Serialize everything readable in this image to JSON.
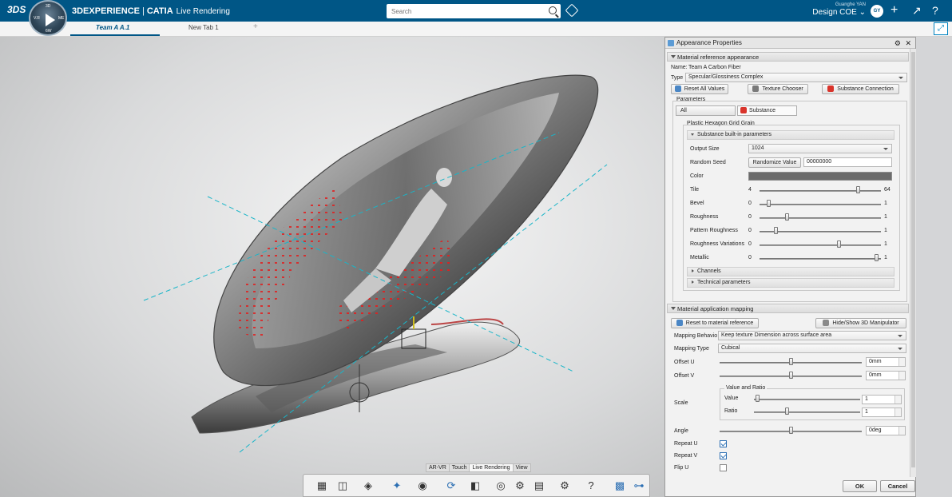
{
  "header": {
    "brand_prefix": "3DEXPERIENCE",
    "brand_app": "CATIA",
    "brand_context": "Live Rendering",
    "search_placeholder": "Search",
    "user_name": "Guanghe YAN",
    "collaborative_space": "Design COE",
    "avatar_initials": "GY",
    "compass_letters": {
      "top": "3D",
      "left": "V.R",
      "right": "ME",
      "bottom": "6W"
    }
  },
  "tabs": [
    {
      "label": "Team A A.1",
      "active": true
    },
    {
      "label": "New Tab 1",
      "active": false
    }
  ],
  "new_tab_symbol": "+",
  "workbench_tabs": [
    "AR-VR",
    "Touch",
    "Live Rendering",
    "View"
  ],
  "workbench_active": "Live Rendering",
  "toolbar_icons": [
    "scene-icon",
    "environment-icon",
    "material-icon",
    "lighting-icon",
    "camera-icon",
    "render-icon",
    "snapshot-icon",
    "turntable-icon",
    "settings-icon",
    "library-icon",
    "preferences-icon",
    "help-icon",
    "texture-icon",
    "tree-icon"
  ],
  "panel": {
    "title": "Appearance Properties",
    "material_reference": {
      "section_label": "Material reference appearance",
      "name_label": "Name:",
      "name_value": "Team A Carbon Fiber",
      "type_label": "Type",
      "type_value": "Specular/Glossiness Complex",
      "reset_label": "Reset All Values",
      "texture_label": "Texture Chooser",
      "substance_label": "Substance Connection",
      "parameters_label": "Parameters",
      "tab_all": "All",
      "tab_substance": "Substance",
      "group_label": "Plastic Hexagon Grid Grain",
      "builtin_label": "Substance built-in parameters",
      "output_size_label": "Output Size",
      "output_size_value": "1024",
      "random_seed_label": "Random Seed",
      "randomize_label": "Randomize Value",
      "random_seed_value": "00000000",
      "color_label": "Color",
      "color_value": "#6b6b6b",
      "sliders": [
        {
          "label": "Tile",
          "min": "4",
          "max": "64",
          "value": 0.82
        },
        {
          "label": "Bevel",
          "min": "0",
          "max": "1",
          "value": 0.06
        },
        {
          "label": "Roughness",
          "min": "0",
          "max": "1",
          "value": 0.22
        },
        {
          "label": "Pattern Roughness",
          "min": "0",
          "max": "1",
          "value": 0.12
        },
        {
          "label": "Roughness Variations",
          "min": "0",
          "max": "1",
          "value": 0.66
        },
        {
          "label": "Metallic",
          "min": "0",
          "max": "1",
          "value": 0.98
        }
      ],
      "channels_label": "Channels",
      "technical_label": "Technical parameters"
    },
    "mapping": {
      "section_label": "Material application mapping",
      "reset_label": "Reset to material reference",
      "manip_label": "Hide/Show 3D Manipulator",
      "behavior_label": "Mapping Behavio",
      "behavior_value": "Keep texture Dimension across surface area",
      "type_label": "Mapping Type",
      "type_value": "Cubical",
      "offset_u_label": "Offset U",
      "offset_u_value": "0mm",
      "offset_v_label": "Offset V",
      "offset_v_value": "0mm",
      "scale_label": "Scale",
      "value_ratio_label": "Value and Ratio",
      "value_label": "Value",
      "value_value": "1",
      "ratio_label": "Ratio",
      "ratio_value": "1",
      "angle_label": "Angle",
      "angle_value": "0deg",
      "repeat_u_label": "Repeat U",
      "repeat_u": true,
      "repeat_v_label": "Repeat V",
      "repeat_v": true,
      "flip_u_label": "Flip U",
      "flip_u": false
    },
    "ok_label": "OK",
    "cancel_label": "Cancel"
  },
  "colors": {
    "topbar": "#005686",
    "accent": "#0083c1",
    "substance_red": "#d9342b"
  }
}
